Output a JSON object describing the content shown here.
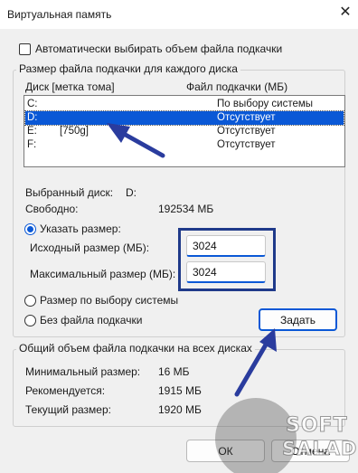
{
  "window": {
    "title": "Виртуальная память",
    "close_glyph": "✕"
  },
  "auto_manage": {
    "label": "Автоматически выбирать объем файла подкачки",
    "checked": false
  },
  "per_disk": {
    "caption": "Размер файла подкачки для каждого диска",
    "col_disk": "Диск [метка тома]",
    "col_paging": "Файл подкачки (МБ)",
    "drives": [
      {
        "letter": "C:",
        "label": "",
        "paging": "По выбору системы",
        "selected": false
      },
      {
        "letter": "D:",
        "label": "",
        "paging": "Отсутствует",
        "selected": true
      },
      {
        "letter": "E:",
        "label": "[750g]",
        "paging": "Отсутствует",
        "selected": false
      },
      {
        "letter": "F:",
        "label": "",
        "paging": "Отсутствует",
        "selected": false
      }
    ],
    "selected_disk_label": "Выбранный диск:",
    "selected_disk_value": "D:",
    "free_label": "Свободно:",
    "free_value": "192534 МБ",
    "custom_size_label": "Указать размер:",
    "initial_label": "Исходный размер (МБ):",
    "initial_value": "3024",
    "max_label": "Максимальный размер (МБ):",
    "max_value": "3024",
    "system_managed_label": "Размер по выбору системы",
    "no_paging_label": "Без файла подкачки",
    "set_button": "Задать",
    "selected_option": "custom"
  },
  "totals": {
    "caption": "Общий объем файла подкачки на всех дисках",
    "min_label": "Минимальный размер:",
    "min_value": "16 МБ",
    "recommended_label": "Рекомендуется:",
    "recommended_value": "1915 МБ",
    "current_label": "Текущий размер:",
    "current_value": "1920 МБ"
  },
  "buttons": {
    "ok": "ОК",
    "cancel": "Отмена"
  },
  "watermark": {
    "line1": "SOFT",
    "line2": "SALAD"
  },
  "colors": {
    "accent": "#0a58d6",
    "annotation_blue": "#2a3c9e",
    "highlight_box": "#1f3a8a"
  }
}
